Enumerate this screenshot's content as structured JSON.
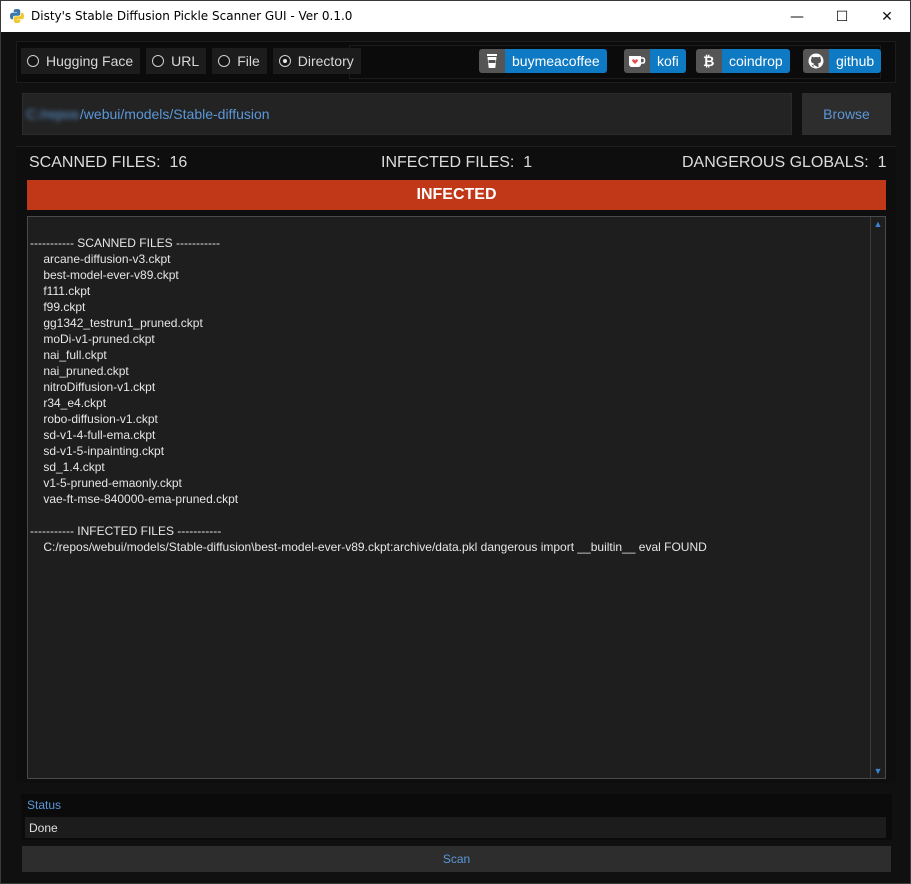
{
  "window": {
    "title": "Disty's Stable Diffusion Pickle Scanner GUI - Ver 0.1.0",
    "minimize_glyph": "—",
    "maximize_glyph": "☐",
    "close_glyph": "✕"
  },
  "source_options": [
    {
      "label": "Hugging Face",
      "selected": false
    },
    {
      "label": "URL",
      "selected": false
    },
    {
      "label": "File",
      "selected": false
    },
    {
      "label": "Directory",
      "selected": true
    }
  ],
  "links": [
    {
      "label": "buymeacoffee",
      "icon": "coffee-cup-icon"
    },
    {
      "label": "kofi",
      "icon": "kofi-cup-icon"
    },
    {
      "label": "coindrop",
      "icon": "bitcoin-icon"
    },
    {
      "label": "github",
      "icon": "github-icon"
    }
  ],
  "path": {
    "blurred_prefix": "C:/repos",
    "value": "/webui/models/Stable-diffusion",
    "browse_label": "Browse"
  },
  "stats": {
    "scanned_label": "SCANNED FILES:",
    "scanned_value": "16",
    "infected_label": "INFECTED FILES:",
    "infected_value": "1",
    "dangerous_label": "DANGEROUS GLOBALS:",
    "dangerous_value": "1"
  },
  "result_banner": "INFECTED",
  "log": {
    "scanned_header": "----------- SCANNED FILES -----------",
    "scanned_files": [
      "arcane-diffusion-v3.ckpt",
      "best-model-ever-v89.ckpt",
      "f111.ckpt",
      "f99.ckpt",
      "gg1342_testrun1_pruned.ckpt",
      "moDi-v1-pruned.ckpt",
      "nai_full.ckpt",
      "nai_pruned.ckpt",
      "nitroDiffusion-v1.ckpt",
      "r34_e4.ckpt",
      "robo-diffusion-v1.ckpt",
      "sd-v1-4-full-ema.ckpt",
      "sd-v1-5-inpainting.ckpt",
      "sd_1.4.ckpt",
      "v1-5-pruned-emaonly.ckpt",
      "vae-ft-mse-840000-ema-pruned.ckpt"
    ],
    "infected_header": "----------- INFECTED FILES -----------",
    "infected_files": [
      "C:/repos/webui/models/Stable-diffusion\\best-model-ever-v89.ckpt:archive/data.pkl dangerous import __builtin__ eval FOUND"
    ]
  },
  "status": {
    "label": "Status",
    "value": "Done"
  },
  "scan_label": "Scan",
  "colors": {
    "banner": "#c03818",
    "accent": "#5b97d8",
    "badge": "#0e7ac4"
  }
}
